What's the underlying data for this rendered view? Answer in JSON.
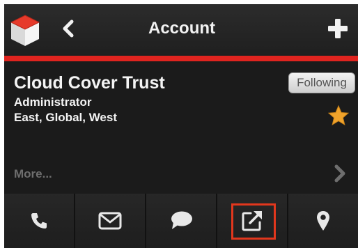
{
  "header": {
    "title": "Account",
    "logo_icon": "cube-logo-icon",
    "back_icon": "chevron-left-icon",
    "add_icon": "plus-icon"
  },
  "account": {
    "name": "Cloud Cover Trust",
    "role": "Administrator",
    "regions": "East, Global, West",
    "following_label": "Following",
    "favorite_icon": "star-icon",
    "favorite_color": "#f0a32b"
  },
  "more": {
    "label": "More...",
    "icon": "chevron-right-icon"
  },
  "toolbar": {
    "items": [
      {
        "icon": "phone-icon"
      },
      {
        "icon": "mail-icon"
      },
      {
        "icon": "chat-icon"
      },
      {
        "icon": "external-link-icon",
        "highlighted": true
      },
      {
        "icon": "map-pin-icon"
      }
    ]
  },
  "colors": {
    "accent": "#e0241f",
    "background": "#1e1e1e",
    "highlight": "#e2371d"
  }
}
